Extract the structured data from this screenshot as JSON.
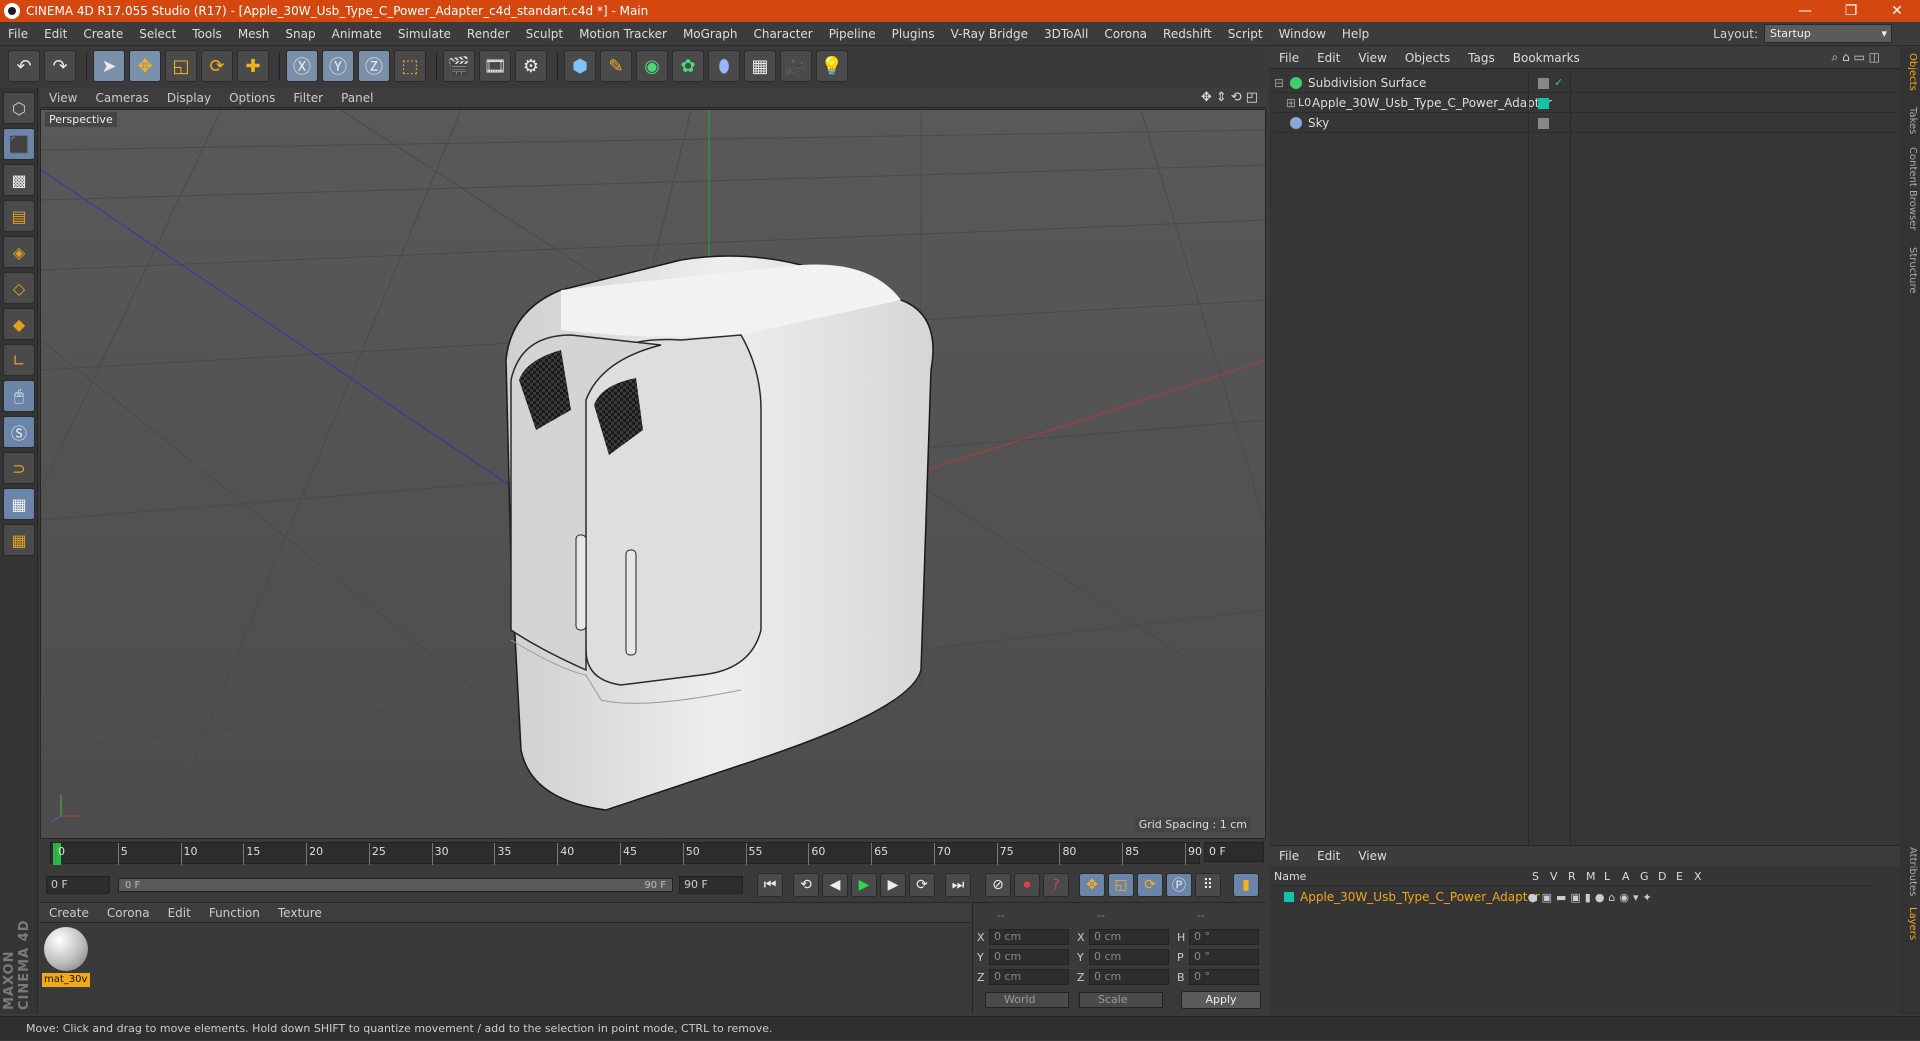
{
  "window": {
    "title": "CINEMA 4D R17.055 Studio (R17) - [Apple_30W_Usb_Type_C_Power_Adapter_c4d_standart.c4d *] - Main",
    "controls": [
      "—",
      "❐",
      "✕"
    ]
  },
  "menubar": {
    "items": [
      "File",
      "Edit",
      "Create",
      "Select",
      "Tools",
      "Mesh",
      "Snap",
      "Animate",
      "Simulate",
      "Render",
      "Sculpt",
      "Motion Tracker",
      "MoGraph",
      "Character",
      "Pipeline",
      "Plugins",
      "V-Ray Bridge",
      "3DToAll",
      "Corona",
      "Redshift",
      "Script",
      "Window",
      "Help"
    ],
    "layout_label": "Layout:",
    "layout_value": "Startup"
  },
  "viewport": {
    "menu": [
      "View",
      "Cameras",
      "Display",
      "Options",
      "Filter",
      "Panel"
    ],
    "label": "Perspective",
    "grid_spacing": "Grid Spacing : 1 cm"
  },
  "timeline": {
    "ticks": [
      "0",
      "5",
      "10",
      "15",
      "20",
      "25",
      "30",
      "35",
      "40",
      "45",
      "50",
      "55",
      "60",
      "65",
      "70",
      "75",
      "80",
      "85",
      "90"
    ],
    "current": "0 F"
  },
  "transport": {
    "start": "0 F",
    "range_start": "0 F",
    "range_end": "90 F",
    "end": "90 F"
  },
  "materials": {
    "menu": [
      "Create",
      "Corona",
      "Edit",
      "Function",
      "Texture"
    ],
    "items": [
      {
        "name": "mat_30v"
      }
    ]
  },
  "coords": {
    "header": [
      "--",
      "--",
      "--"
    ],
    "rows": [
      {
        "a": "X",
        "av": "0 cm",
        "b": "X",
        "bv": "0 cm",
        "c": "H",
        "cv": "0 °"
      },
      {
        "a": "Y",
        "av": "0 cm",
        "b": "Y",
        "bv": "0 cm",
        "c": "P",
        "cv": "0 °"
      },
      {
        "a": "Z",
        "av": "0 cm",
        "b": "Z",
        "bv": "0 cm",
        "c": "B",
        "cv": "0 °"
      }
    ],
    "world": "World",
    "scale": "Scale",
    "apply": "Apply"
  },
  "objects": {
    "menu": [
      "File",
      "Edit",
      "View",
      "Objects",
      "Tags",
      "Bookmarks"
    ],
    "items": [
      {
        "name": "Subdivision Surface"
      },
      {
        "name": "Apple_30W_Usb_Type_C_Power_Adapter"
      },
      {
        "name": "Sky"
      }
    ]
  },
  "layers": {
    "menu": [
      "File",
      "Edit",
      "View"
    ],
    "headers": [
      "Name",
      "S",
      "V",
      "R",
      "M",
      "L",
      "A",
      "G",
      "D",
      "E",
      "X"
    ],
    "row": "Apple_30W_Usb_Type_C_Power_Adapter"
  },
  "sidetabs": [
    "Objects",
    "Takes",
    "Content Browser",
    "Structure",
    "Attributes",
    "Layers"
  ],
  "branding": "MAXON CINEMA 4D",
  "status": "Move: Click and drag to move elements. Hold down SHIFT to quantize movement / add to the selection in point mode, CTRL to remove."
}
